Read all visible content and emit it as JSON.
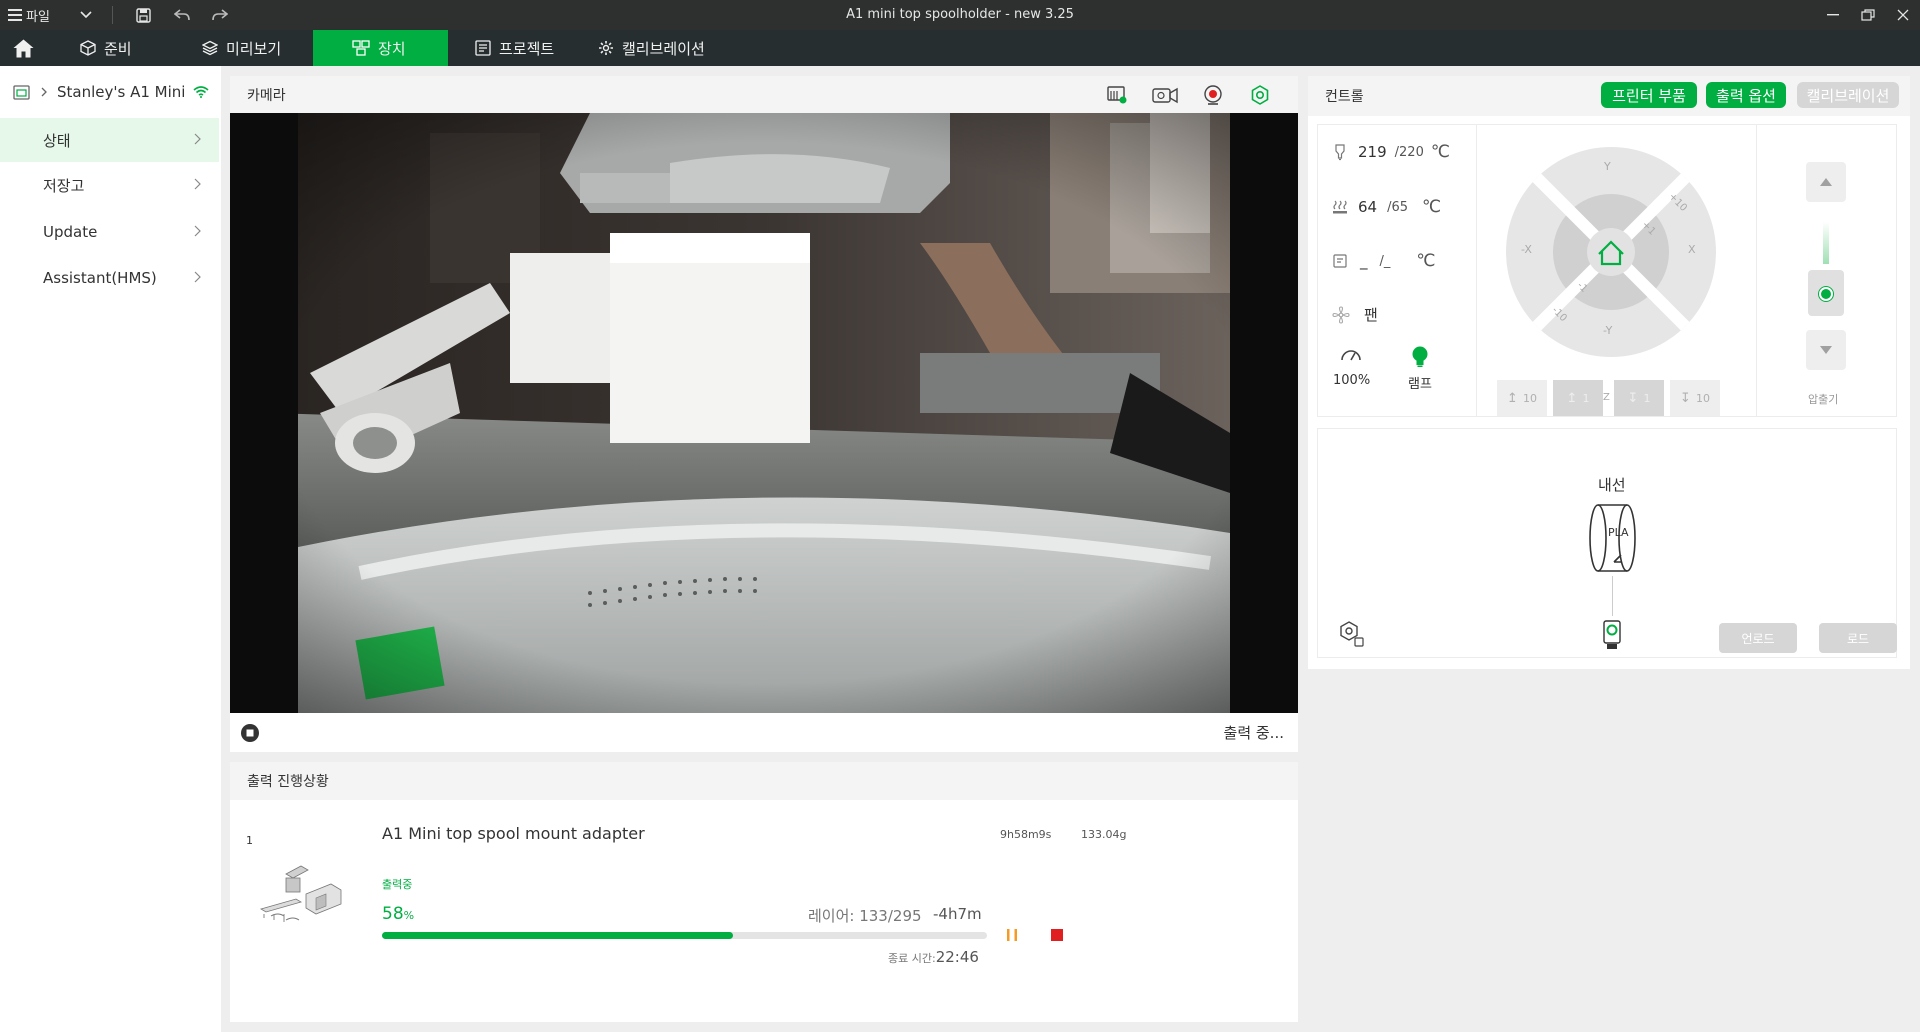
{
  "window": {
    "title": "A1 mini top spoolholder - new 3.25",
    "file_menu_label": "파일"
  },
  "tabs": [
    {
      "label": "준비"
    },
    {
      "label": "미리보기"
    },
    {
      "label": "장치",
      "active": true
    },
    {
      "label": "프로젝트"
    },
    {
      "label": "캘리브레이션"
    }
  ],
  "sidebar": {
    "device_name": "Stanley's A1 Mini",
    "items": [
      {
        "label": "상태",
        "active": true
      },
      {
        "label": "저장고"
      },
      {
        "label": "Update"
      },
      {
        "label": "Assistant(HMS)"
      }
    ]
  },
  "camera": {
    "header": "카메라",
    "status": "출력 중..."
  },
  "control": {
    "header": "컨트롤",
    "buttons": {
      "printer_parts": "프린터 부품",
      "print_options": "출력 옵션",
      "calibration": "캘리브레이션"
    },
    "nozzle": {
      "current": "219",
      "target": "/220",
      "unit": "℃"
    },
    "bed": {
      "current": "64",
      "target": "/65",
      "unit": "℃"
    },
    "chamber": {
      "current": "_",
      "target": "/_",
      "unit": "℃"
    },
    "fan_label": "팬",
    "speed": "100%",
    "lamp_label": "램프",
    "jog": {
      "labels": {
        "y_pos": "Y",
        "y_neg": "-Y",
        "x_pos": "X",
        "x_neg": "-X",
        "plus10": "+10",
        "plus1": "+1",
        "minus1": "-1",
        "minus10": "-10"
      },
      "z_buttons": [
        "10",
        "1",
        "Z",
        "1",
        "10"
      ]
    },
    "extruder_label": "압출기",
    "ams": {
      "slot_label": "내선",
      "filament": "PLA",
      "unload_label": "언로드",
      "load_label": "로드"
    }
  },
  "progress": {
    "header": "출력 진행상황",
    "plate_number": "1",
    "job_name": "A1 Mini top spool mount adapter",
    "duration": "9h58m9s",
    "weight": "133.04g",
    "status": "출력중",
    "percent": "58",
    "percent_unit": "%",
    "percent_value": 0.58,
    "layer": "레이어: 133/295",
    "remaining": "-4h7m",
    "end_label": "종료 시간:",
    "end_time": "22:46"
  },
  "colors": {
    "accent": "#00ae42",
    "titlebar": "#2e3030",
    "tabbar": "#262e30",
    "pause": "#f59a23",
    "stop": "#e02020"
  }
}
